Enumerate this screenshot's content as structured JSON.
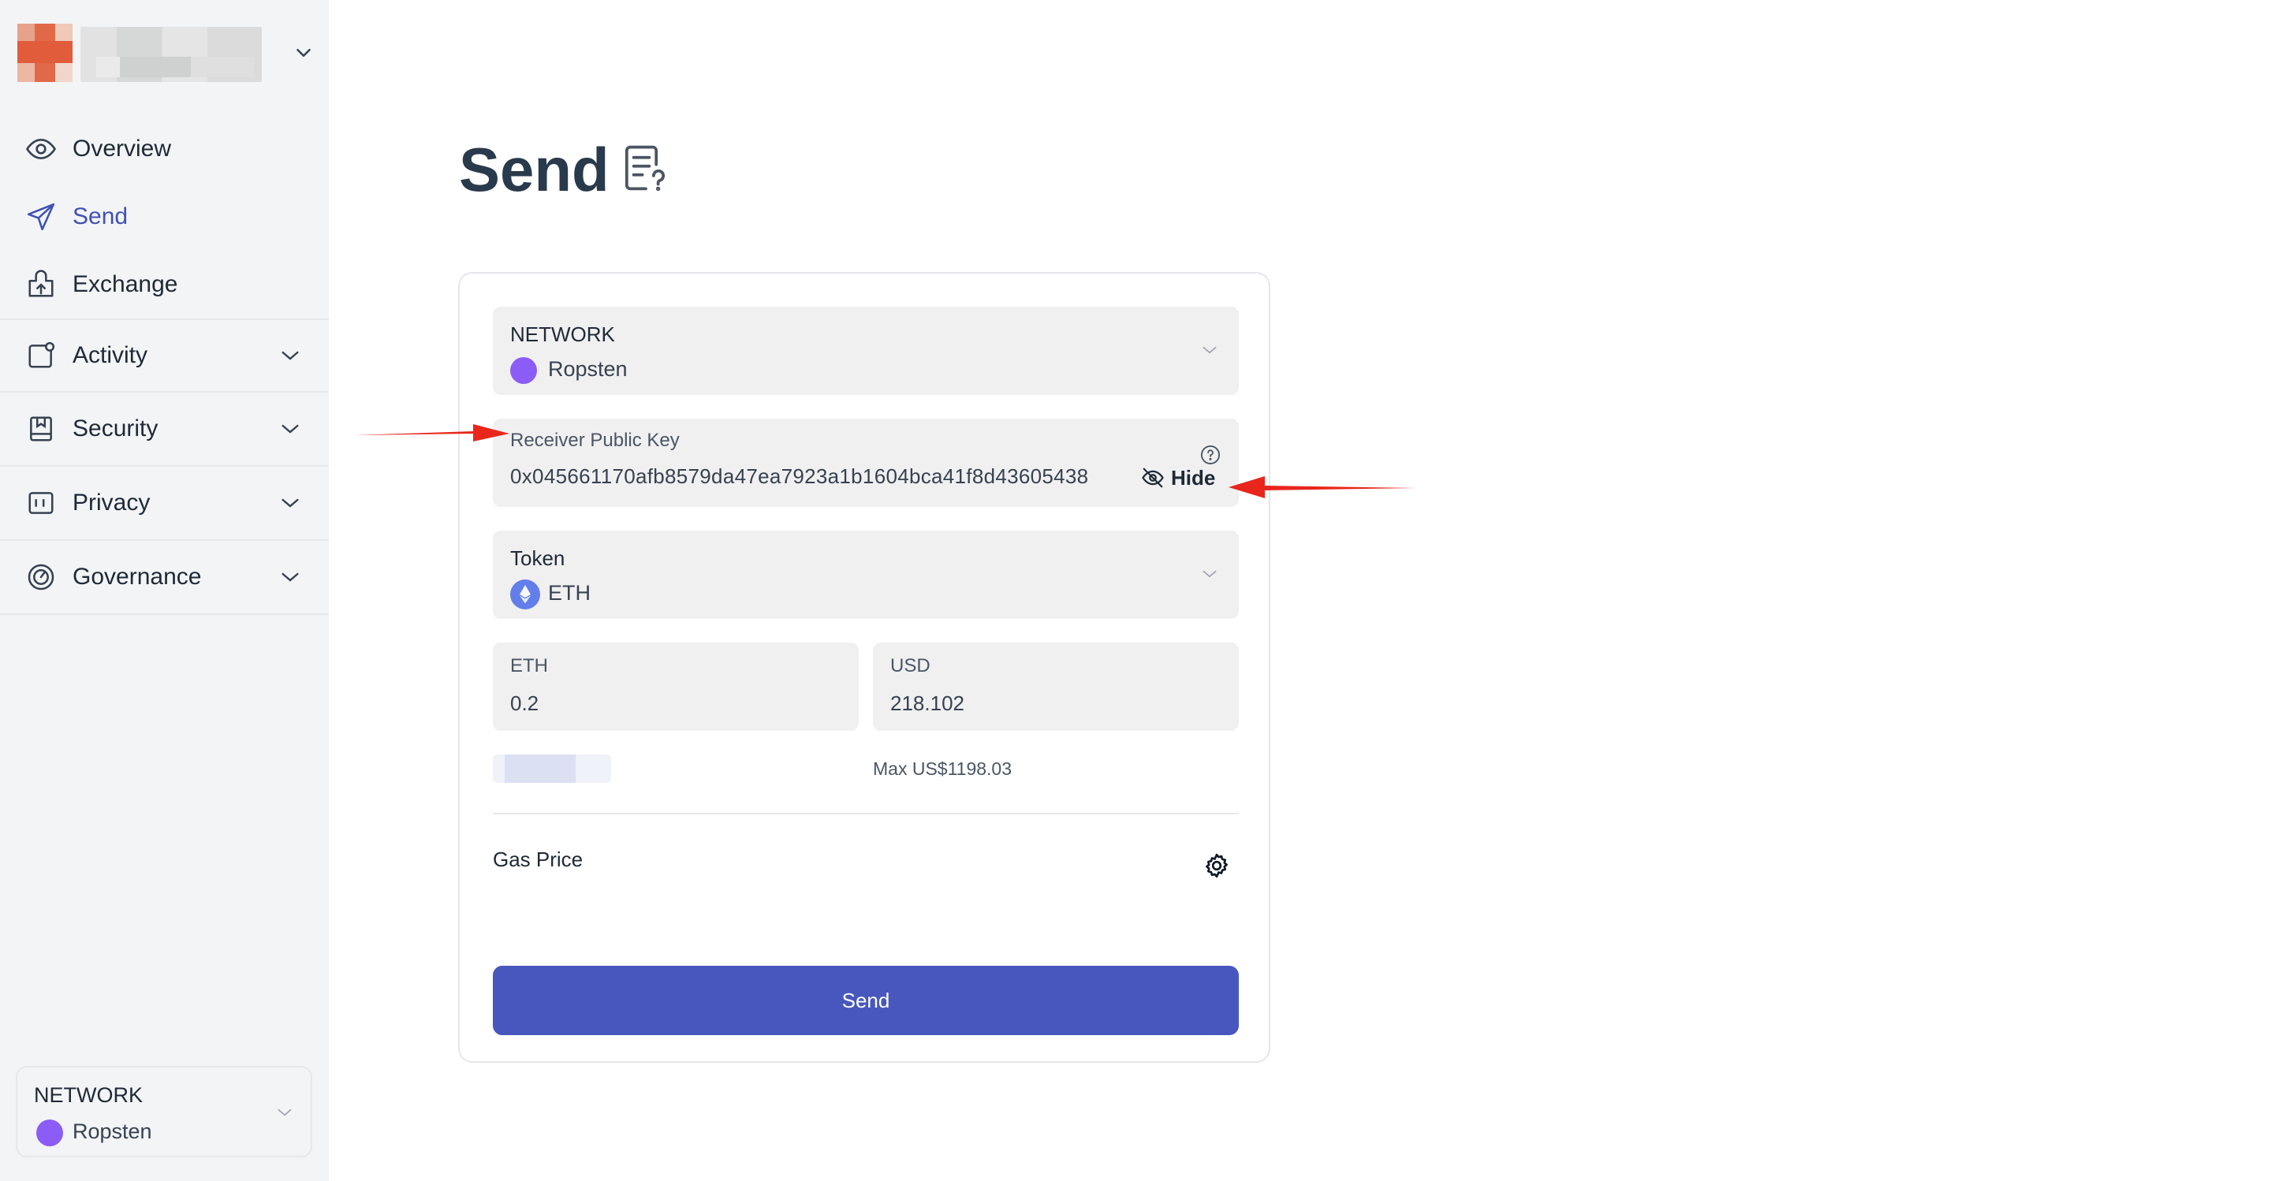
{
  "sidebar": {
    "nav": [
      {
        "label": "Overview",
        "icon": "eye-icon"
      },
      {
        "label": "Send",
        "icon": "send-icon"
      },
      {
        "label": "Exchange",
        "icon": "exchange-icon"
      },
      {
        "label": "Activity",
        "icon": "activity-icon"
      },
      {
        "label": "Security",
        "icon": "security-icon"
      },
      {
        "label": "Privacy",
        "icon": "privacy-icon"
      },
      {
        "label": "Governance",
        "icon": "governance-icon"
      }
    ],
    "active": "Send",
    "network": {
      "label": "NETWORK",
      "value": "Ropsten"
    }
  },
  "main": {
    "title": "Send",
    "network": {
      "label": "NETWORK",
      "value": "Ropsten"
    },
    "receiver": {
      "label": "Receiver Public Key",
      "value": "0x045661170afb8579da47ea7923a1b1604bca41f8d43605438",
      "hide_label": "Hide"
    },
    "token": {
      "label": "Token",
      "value": "ETH"
    },
    "amount_eth": {
      "label": "ETH",
      "value": "0.2"
    },
    "amount_usd": {
      "label": "USD",
      "value": "218.102"
    },
    "max": "Max US$1198.03",
    "gas_price_label": "Gas Price",
    "send_button": "Send"
  },
  "colors": {
    "accent": "#4757bd",
    "active_nav": "#3f51b5",
    "sidebar_bg": "#f3f4f6",
    "field_bg": "#f0f0f1",
    "ropsten_dot": "#8b5cf6",
    "eth_coin": "#627eea",
    "annotation_arrow": "#e8261c"
  }
}
